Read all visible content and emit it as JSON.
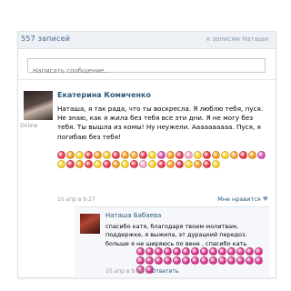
{
  "wall": {
    "record_count": "557 записей",
    "all_link": "к записям Наташи"
  },
  "compose": {
    "placeholder": "Написать сообщение..."
  },
  "post": {
    "author": "Екатерина Комиченко",
    "online": "Online",
    "text": "Наташа, я так рада, что ты воскресла. Я люблю тебя, пуся. Не знаю, как я жила без тебя все эти дни. Я не могу без тебя. Ты вышла из комы! Ну неужели. Аааааааааа. Пуся, я погибаю без тебя!",
    "date": "10 апр в 9:27",
    "like_label": "Мне нравится",
    "emoji_colors": [
      "#e8364a",
      "#f59b1b",
      "#f7d21e",
      "#e8364a",
      "#f59b1b",
      "#f7c71e",
      "#e8364a",
      "#f59b1b",
      "#f0a22e",
      "#e8364a",
      "#f7d21e",
      "#d94bb1",
      "#f59b1b",
      "#e8364a",
      "#f5a7c4",
      "#f7d21e",
      "#e8364a",
      "#f59b1b",
      "#f7d21e",
      "#f0a22e",
      "#e8364a",
      "#f59b1b",
      "#d94bb1",
      "#f7d21e",
      "#e8364a",
      "#f59b1b",
      "#e8364a",
      "#f7d21e",
      "#e8364a",
      "#f59b1b",
      "#f7d21e",
      "#e8364a",
      "#f5a7c4",
      "#f7d21e",
      "#e8364a",
      "#f59b1b",
      "#e8364a",
      "#f7d21e",
      "#f59b1b",
      "#e8364a",
      "#f7d21e"
    ]
  },
  "reply": {
    "author": "Наташа Бабаева",
    "text": "спасибо катя, благодаря твоим молитвам, поддержке, я выжила, эт дурацкий передоз. больше я не ширяюсь по вене , спасибо кать",
    "date": "10 апр в 9:29",
    "reply_label": "Ответить",
    "emoji_colors": [
      "#d9328a",
      "#d9328a",
      "#d9328a",
      "#d9328a",
      "#d9328a",
      "#d9328a",
      "#d9328a",
      "#d9328a",
      "#d9328a",
      "#d9328a",
      "#d9328a",
      "#d9328a",
      "#d9328a",
      "#d9328a",
      "#d9328a",
      "#d9328a",
      "#d9328a",
      "#d9328a",
      "#d9328a",
      "#d9328a",
      "#d9328a",
      "#d9328a",
      "#d9328a",
      "#d9328a",
      "#d9328a",
      "#d9328a",
      "#d9328a",
      "#d9328a",
      "#d9328a",
      "#d9328a"
    ]
  }
}
